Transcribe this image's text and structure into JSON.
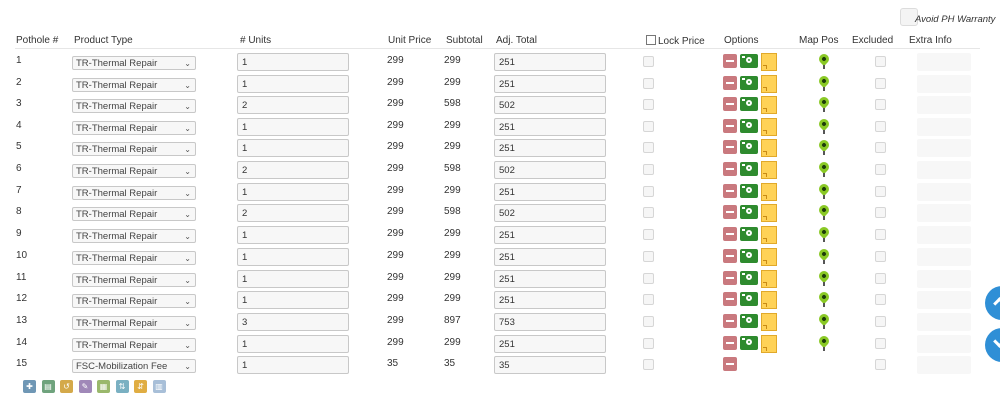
{
  "avoid_warranty": {
    "label": "Avoid PH Warranty",
    "checked": false
  },
  "headers": {
    "pothole": "Pothole #",
    "product_type": "Product Type",
    "units": "# Units",
    "unit_price": "Unit Price",
    "subtotal": "Subtotal",
    "adj_total": "Adj. Total",
    "lock_price": "Lock Price",
    "options": "Options",
    "map_pos": "Map Pos",
    "excluded": "Excluded",
    "extra_info": "Extra Info"
  },
  "rows": [
    {
      "num": "1",
      "product": "TR-Thermal Repair",
      "units": "1",
      "unit_price": "299",
      "subtotal": "299",
      "adj_total": "251"
    },
    {
      "num": "2",
      "product": "TR-Thermal Repair",
      "units": "1",
      "unit_price": "299",
      "subtotal": "299",
      "adj_total": "251"
    },
    {
      "num": "3",
      "product": "TR-Thermal Repair",
      "units": "2",
      "unit_price": "299",
      "subtotal": "598",
      "adj_total": "502"
    },
    {
      "num": "4",
      "product": "TR-Thermal Repair",
      "units": "1",
      "unit_price": "299",
      "subtotal": "299",
      "adj_total": "251"
    },
    {
      "num": "5",
      "product": "TR-Thermal Repair",
      "units": "1",
      "unit_price": "299",
      "subtotal": "299",
      "adj_total": "251"
    },
    {
      "num": "6",
      "product": "TR-Thermal Repair",
      "units": "2",
      "unit_price": "299",
      "subtotal": "598",
      "adj_total": "502"
    },
    {
      "num": "7",
      "product": "TR-Thermal Repair",
      "units": "1",
      "unit_price": "299",
      "subtotal": "299",
      "adj_total": "251"
    },
    {
      "num": "8",
      "product": "TR-Thermal Repair",
      "units": "2",
      "unit_price": "299",
      "subtotal": "598",
      "adj_total": "502"
    },
    {
      "num": "9",
      "product": "TR-Thermal Repair",
      "units": "1",
      "unit_price": "299",
      "subtotal": "299",
      "adj_total": "251"
    },
    {
      "num": "10",
      "product": "TR-Thermal Repair",
      "units": "1",
      "unit_price": "299",
      "subtotal": "299",
      "adj_total": "251"
    },
    {
      "num": "11",
      "product": "TR-Thermal Repair",
      "units": "1",
      "unit_price": "299",
      "subtotal": "299",
      "adj_total": "251"
    },
    {
      "num": "12",
      "product": "TR-Thermal Repair",
      "units": "1",
      "unit_price": "299",
      "subtotal": "299",
      "adj_total": "251"
    },
    {
      "num": "13",
      "product": "TR-Thermal Repair",
      "units": "3",
      "unit_price": "299",
      "subtotal": "897",
      "adj_total": "753"
    },
    {
      "num": "14",
      "product": "TR-Thermal Repair",
      "units": "1",
      "unit_price": "299",
      "subtotal": "299",
      "adj_total": "251"
    },
    {
      "num": "15",
      "product": "FSC-Mobilization Fee",
      "units": "1",
      "unit_price": "35",
      "subtotal": "35",
      "adj_total": "35",
      "fee": true
    }
  ],
  "toolbar": [
    {
      "icon": "plus-icon",
      "glyph": "✚",
      "color": "#6f97b5"
    },
    {
      "icon": "id-card-icon",
      "glyph": "▤",
      "color": "#6fa37d"
    },
    {
      "icon": "undo-icon",
      "glyph": "↺",
      "color": "#d4a94a"
    },
    {
      "icon": "edit-icon",
      "glyph": "✎",
      "color": "#a088b8"
    },
    {
      "icon": "table-icon",
      "glyph": "▦",
      "color": "#9ab86c"
    },
    {
      "icon": "sort-numeric-icon",
      "glyph": "⇅",
      "color": "#7ab0c2"
    },
    {
      "icon": "sort-alpha-icon",
      "glyph": "⇵",
      "color": "#e0ad42"
    },
    {
      "icon": "bar-chart-icon",
      "glyph": "▥",
      "color": "#a8bfd8"
    }
  ],
  "colors": {
    "delete": "#c9797e",
    "camera": "#2e8b2e",
    "note": "#ffd257",
    "pin": "#8ac925",
    "scroll": "#2f8fd6"
  }
}
